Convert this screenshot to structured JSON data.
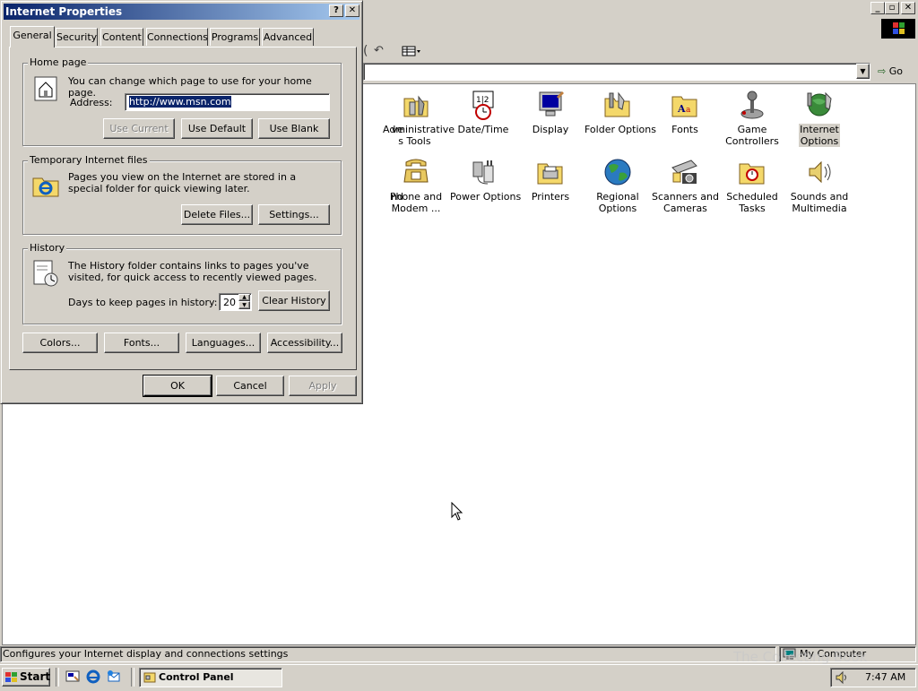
{
  "background_window": {
    "address_value": "",
    "go_label": "Go",
    "items_row1": [
      {
        "label": "ve\ns"
      },
      {
        "label": "Administrative\nTools"
      },
      {
        "label": "Date/Time"
      },
      {
        "label": "Display"
      },
      {
        "label": "Folder Options"
      },
      {
        "label": "Fonts"
      },
      {
        "label": "Game\nControllers"
      },
      {
        "label": "Internet\nOptions"
      }
    ],
    "items_row2": [
      {
        "label": "nd\n..."
      },
      {
        "label": "Phone and\nModem ..."
      },
      {
        "label": "Power Options"
      },
      {
        "label": "Printers"
      },
      {
        "label": "Regional\nOptions"
      },
      {
        "label": "Scanners and\nCameras"
      },
      {
        "label": "Scheduled\nTasks"
      },
      {
        "label": "Sounds and\nMultimedia"
      }
    ],
    "status_text": "Configures your Internet display and connections settings",
    "status_zone": "My Computer"
  },
  "dialog": {
    "title": "Internet Properties",
    "help_glyph": "?",
    "close_glyph": "✕",
    "tabs": [
      "General",
      "Security",
      "Content",
      "Connections",
      "Programs",
      "Advanced"
    ],
    "home": {
      "group_label": "Home page",
      "description": "You can change which page to use for your home page.",
      "address_label": "Address:",
      "address_value": "http://www.msn.com",
      "use_current": "Use Current",
      "use_default": "Use Default",
      "use_blank": "Use Blank"
    },
    "temp": {
      "group_label": "Temporary Internet files",
      "description": "Pages you view on the Internet are stored in a special folder for quick viewing later.",
      "delete_files": "Delete Files...",
      "settings": "Settings..."
    },
    "history": {
      "group_label": "History",
      "description": "The History folder contains links to pages you've visited, for quick access to recently viewed pages.",
      "days_label": "Days to keep pages in history:",
      "days_value": "20",
      "clear_history": "Clear History"
    },
    "bottom_buttons": [
      "Colors...",
      "Fonts...",
      "Languages...",
      "Accessibility..."
    ],
    "ok": "OK",
    "cancel": "Cancel",
    "apply": "Apply"
  },
  "taskbar": {
    "start": "Start",
    "task": "Control Panel",
    "clock": "7:47 AM"
  },
  "watermark": "The Collecting Book"
}
